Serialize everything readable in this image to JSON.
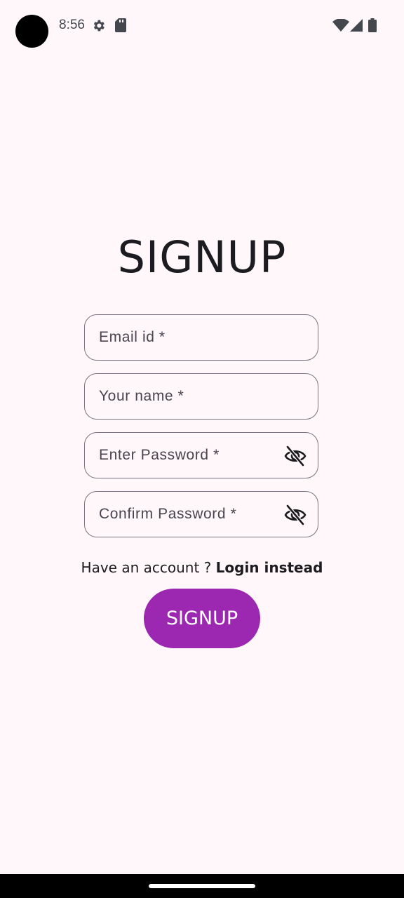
{
  "status_bar": {
    "time": "8:56",
    "icons": [
      "settings-icon",
      "sd-card-icon",
      "wifi-icon",
      "cell-signal-icon",
      "battery-icon"
    ]
  },
  "page": {
    "title": "SIGNUP"
  },
  "form": {
    "email": {
      "placeholder": "Email id *",
      "value": ""
    },
    "name": {
      "placeholder": "Your name *",
      "value": ""
    },
    "password": {
      "placeholder": "Enter Password *",
      "value": "",
      "toggle_icon": "visibility-off-icon"
    },
    "confirm_password": {
      "placeholder": "Confirm Password *",
      "value": "",
      "toggle_icon": "visibility-off-icon"
    }
  },
  "login_prompt": {
    "text": "Have an account ? ",
    "link": "Login instead"
  },
  "signup_button": {
    "label": "SIGNUP"
  },
  "colors": {
    "background": "#fff7fa",
    "accent": "#9c27b0",
    "field_border": "#79747e"
  }
}
